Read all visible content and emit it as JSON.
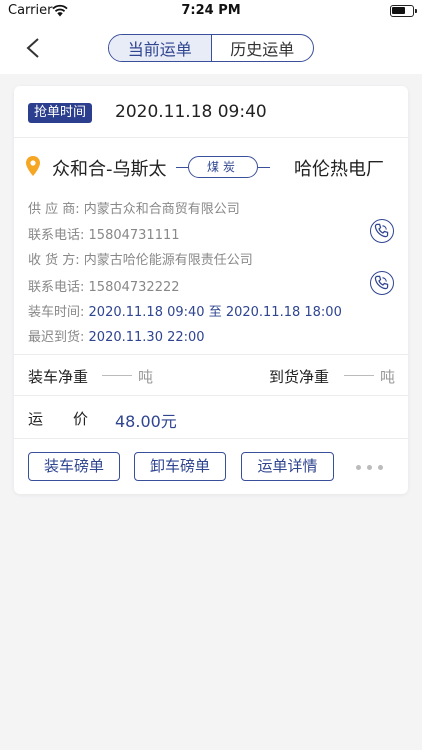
{
  "status_bar": {
    "carrier": "Carrier",
    "time": "7:24 PM"
  },
  "nav": {
    "tabs": [
      {
        "label": "当前运单",
        "active": true
      },
      {
        "label": "历史运单",
        "active": false
      }
    ]
  },
  "waybill": {
    "grab_tag": "抢单时间",
    "grab_time": "2020.11.18 09:40",
    "from": "众和合-乌斯太",
    "cargo": "煤炭",
    "to": "哈伦热电厂",
    "supplier_label": "供 应 商:",
    "supplier": "内蒙古众和合商贸有限公司",
    "supplier_phone_label": "联系电话:",
    "supplier_phone": "15804731111",
    "receiver_label": "收 货 方:",
    "receiver": "内蒙古哈伦能源有限责任公司",
    "receiver_phone_label": "联系电话:",
    "receiver_phone": "15804732222",
    "loading_time_label": "装车时间:",
    "loading_time": "2020.11.18 09:40 至 2020.11.18 18:00",
    "latest_arrival_label": "最迟到货:",
    "latest_arrival": "2020.11.30 22:00",
    "load_net_label": "装车净重",
    "load_net_dash": "——",
    "load_net_unit": "吨",
    "arrive_net_label": "到货净重",
    "arrive_net_dash": "——",
    "arrive_net_unit": "吨",
    "price_label": "运　　价",
    "price": "48.00元",
    "actions": [
      "装车磅单",
      "卸车磅单",
      "运单详情"
    ]
  },
  "colors": {
    "primary": "#2f4590",
    "accent_pin": "#f5a623",
    "background": "#f4f4f5"
  },
  "icons": [
    "wifi-icon",
    "battery-icon",
    "back-chevron-icon",
    "location-pin-icon",
    "phone-icon",
    "more-dots-icon"
  ]
}
